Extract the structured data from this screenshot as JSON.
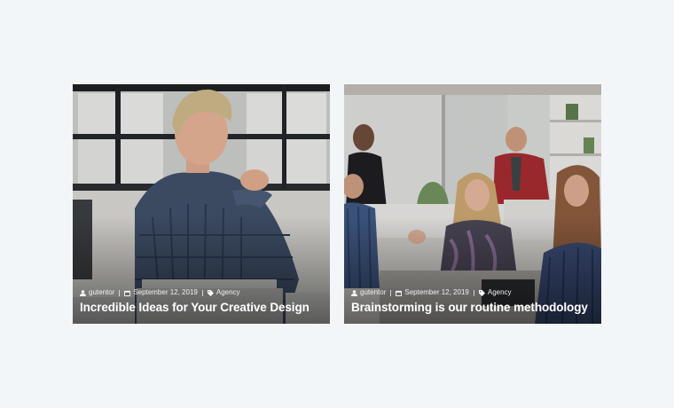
{
  "posts": [
    {
      "author": "gutentor",
      "date": "September 12, 2019",
      "category": "Agency",
      "title": "Incredible Ideas for Your Creative Design",
      "author_icon": "user-icon",
      "date_icon": "calendar-icon",
      "category_icon": "tag-icon"
    },
    {
      "author": "gutentor",
      "date": "September 12, 2019",
      "category": "Agency",
      "title": "Brainstorming is our routine methodology",
      "author_icon": "user-icon",
      "date_icon": "calendar-icon",
      "category_icon": "tag-icon"
    }
  ]
}
